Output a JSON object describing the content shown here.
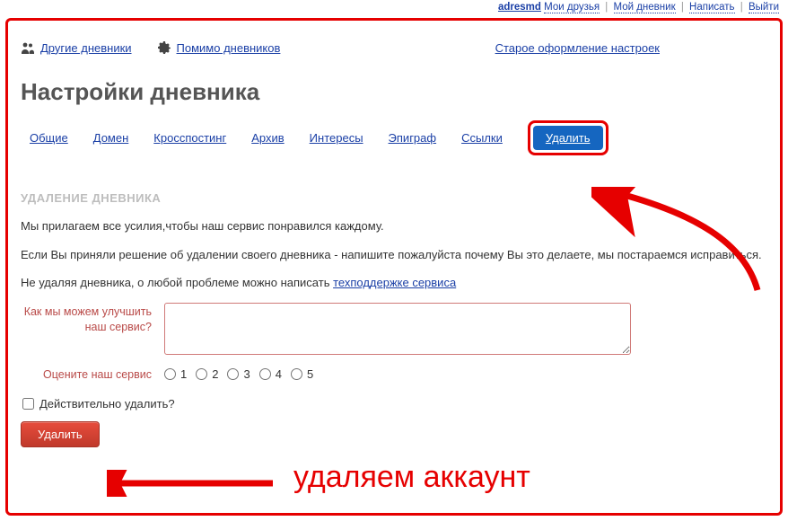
{
  "topbar": {
    "username": "adresmd",
    "links": [
      "Мои друзья",
      "Мой дневник",
      "Написать",
      "Выйти"
    ]
  },
  "nav": {
    "other_diaries": "Другие дневники",
    "besides_diaries": "Помимо дневников",
    "old_style": "Старое оформление настроек"
  },
  "page_title": "Настройки дневника",
  "tabs": [
    "Общие",
    "Домен",
    "Кросспостинг",
    "Архив",
    "Интересы",
    "Эпиграф",
    "Ссылки"
  ],
  "tab_active": "Удалить",
  "section": {
    "title": "УДАЛЕНИЕ ДНЕВНИКА",
    "p1": "Мы прилагаем все усилия,чтобы наш сервис понравился каждому.",
    "p2": "Если Вы приняли решение об удалении своего дневника - напишите пожалуйста почему Вы это делаете, мы постараемся исправиться.",
    "p3_prefix": "Не удаляя дневника, о любой проблеме можно написать ",
    "support_link": "техподдержке сервиса"
  },
  "form": {
    "feedback_label": "Как мы можем улучшить наш сервис?",
    "rating_label": "Оцените наш сервис",
    "rating_options": [
      "1",
      "2",
      "3",
      "4",
      "5"
    ],
    "confirm_label": "Действительно удалить?",
    "delete_button": "Удалить"
  },
  "annotation": "удаляем аккаунт"
}
